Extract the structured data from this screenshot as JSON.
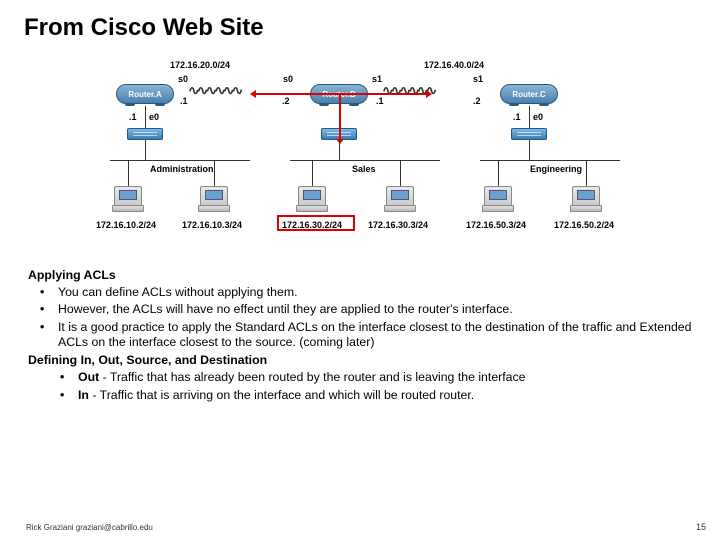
{
  "title": "From Cisco Web Site",
  "diagram": {
    "subnet_top_a": "172.16.20.0/24",
    "subnet_top_c": "172.16.40.0/24",
    "router_a": "Router.A",
    "router_b": "Router.B",
    "router_c": "Router.C",
    "s0": "s0",
    "s1": "s1",
    "e0": "e0",
    "dot1": ".1",
    "dot2": ".2",
    "lan_admin": "Administration",
    "lan_sales": "Sales",
    "lan_eng": "Engineering",
    "host_admin1": "172.16.10.2/24",
    "host_admin2": "172.16.10.3/24",
    "host_sales1": "172.16.30.2/24",
    "host_sales2": "172.16.30.3/24",
    "host_eng1": "172.16.50.2/24",
    "host_eng2": "172.16.50.3/24"
  },
  "section1_heading": "Applying ACLs",
  "section1_bullets": [
    "You can define ACLs without applying them.",
    "However, the ACLs will have no effect until they are applied to the router's interface.",
    "It is a good practice to apply the Standard ACLs on the interface closest to the destination of the traffic and Extended ACLs on the interface closest to the source. (coming later)"
  ],
  "section2_heading": "Defining In, Out, Source, and Destination",
  "section2_bullets": [
    {
      "term": "Out",
      "desc": " - Traffic that has already been routed by the router and is leaving the interface"
    },
    {
      "term": "In",
      "desc": " - Traffic that is arriving on the interface and which will be routed router."
    }
  ],
  "footer_author": "Rick Graziani  graziani@cabrillo.edu",
  "page_number": "15"
}
